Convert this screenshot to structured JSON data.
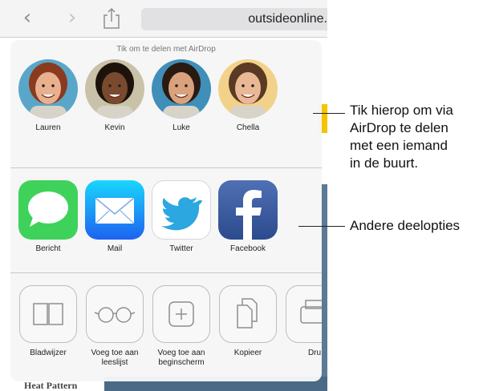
{
  "toolbar": {
    "back_glyph": "‹",
    "forward_glyph": "›",
    "url": "outsideonline."
  },
  "background": {
    "fragment_text": "Heat Pattern"
  },
  "share_sheet": {
    "airdrop_title": "Tik om te delen met AirDrop",
    "people": [
      {
        "name": "Lauren",
        "skin": "#e8b08e",
        "hair": "#8a3a1e",
        "bg": "#5aa6c8"
      },
      {
        "name": "Kevin",
        "skin": "#7a4a2e",
        "hair": "#1e120c",
        "bg": "#c9c2a8"
      },
      {
        "name": "Luke",
        "skin": "#d9a27c",
        "hair": "#2a1a12",
        "bg": "#3f8fb8"
      },
      {
        "name": "Chella",
        "skin": "#e9b894",
        "hair": "#5a3a24",
        "bg": "#f2d28a"
      }
    ],
    "apps": [
      {
        "label": "Bericht",
        "icon": "messages-icon",
        "color": "#3fd25a"
      },
      {
        "label": "Mail",
        "icon": "mail-icon",
        "color": "#2a8df2"
      },
      {
        "label": "Twitter",
        "icon": "twitter-icon",
        "color": "#ffffff"
      },
      {
        "label": "Facebook",
        "icon": "facebook-icon",
        "color": "#3b5998"
      }
    ],
    "actions": [
      {
        "label": "Bladwijzer",
        "icon": "book-icon"
      },
      {
        "label": "Voeg toe aan leeslijst",
        "icon": "glasses-icon"
      },
      {
        "label": "Voeg toe aan beginscherm",
        "icon": "plus-icon"
      },
      {
        "label": "Kopieer",
        "icon": "copy-icon"
      },
      {
        "label": "Dru",
        "icon": "print-icon"
      }
    ]
  },
  "callouts": {
    "airdrop": "Tik hierop om via AirDrop te delen met een iemand in de buurt.",
    "airdrop_lines": [
      "Tik hierop om via",
      "AirDrop te delen",
      "met een iemand",
      "in de buurt."
    ],
    "other": "Andere deelopties"
  }
}
